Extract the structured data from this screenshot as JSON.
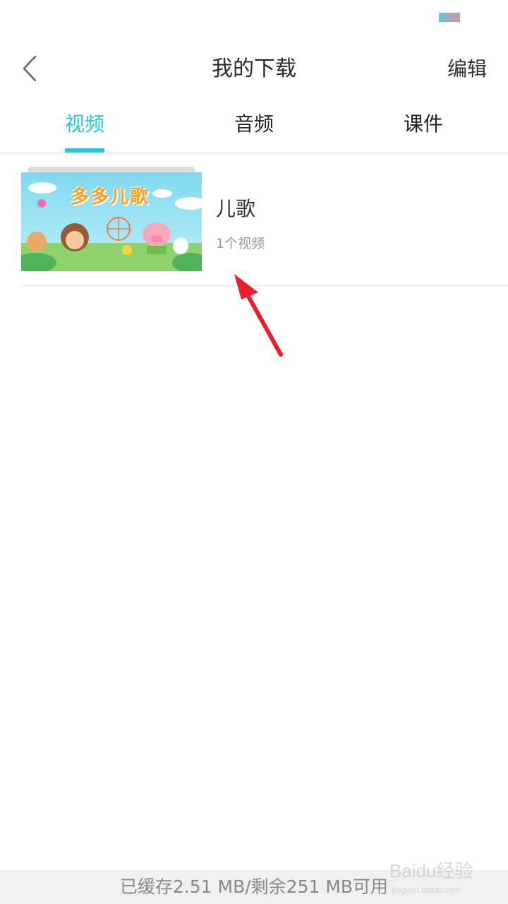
{
  "header": {
    "title": "我的下载",
    "edit_label": "编辑",
    "back_icon": "chevron-left-icon"
  },
  "tabs": [
    {
      "label": "视频",
      "active": true
    },
    {
      "label": "音频",
      "active": false
    },
    {
      "label": "课件",
      "active": false
    }
  ],
  "colors": {
    "accent": "#27c8d3",
    "annotation_arrow": "#e8202c"
  },
  "list": {
    "items": [
      {
        "thumbnail_text": "多多儿歌",
        "title": "儿歌",
        "subtitle": "1个视频"
      }
    ]
  },
  "footer": {
    "storage_text": "已缓存2.51 MB/剩余251 MB可用"
  },
  "watermark": {
    "text": "Baidu经验",
    "subtext": "jingyan.baidu.com"
  }
}
